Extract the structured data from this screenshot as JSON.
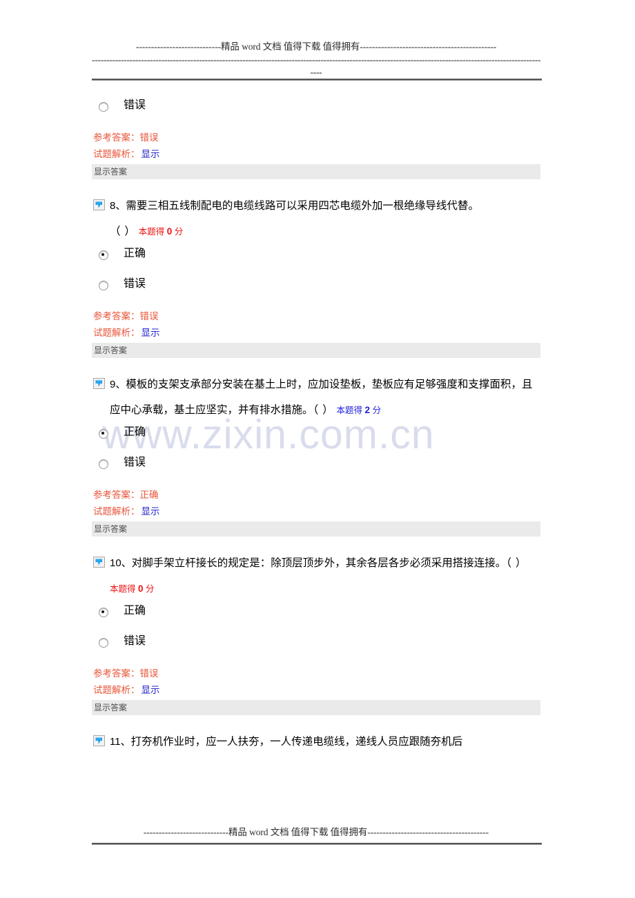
{
  "header": {
    "line1": "----------------------------精品 word 文档  值得下载  值得拥有---------------------------------------------",
    "line2": "-----------------------------------------------------------------------------------------------------------------------------------------------------------------",
    "line3": "----"
  },
  "footer": {
    "line1": "----------------------------精品 word 文档  值得下载  值得拥有----------------------------------------"
  },
  "watermark": {
    "text": "www.zixin.com.cn"
  },
  "labels": {
    "reference_answer": "参考答案：",
    "explanation": "试题解析：",
    "show_link": "显示",
    "show_answer_bar": "显示答案",
    "option_true": "正确",
    "option_false": "错误"
  },
  "blocks": [
    {
      "id": "q7-tail",
      "type": "answer-tail",
      "options": [
        {
          "label": "错误",
          "checked": false
        }
      ],
      "reference_answer": "错误",
      "explanation_link": "显示",
      "show_answer_bar": "显示答案"
    },
    {
      "id": "q8",
      "type": "question",
      "number": "8、",
      "text": "需要三相五线制配电的电缆线路可以采用四芯电缆外加一根绝缘导线代替。",
      "blank": "（  ）",
      "score_text_prefix": "本题得",
      "score_value": "0",
      "score_text_suffix": "分",
      "score_color": "red",
      "options": [
        {
          "label": "正确",
          "checked": true
        },
        {
          "label": "错误",
          "checked": false
        }
      ],
      "reference_answer": "错误",
      "explanation_link": "显示",
      "show_answer_bar": "显示答案"
    },
    {
      "id": "q9",
      "type": "question",
      "number": "9、",
      "text": "模板的支架支承部分安装在基土上时，应加设垫板，垫板应有足够强度和支撑面积，且应中心承载，基土应坚实，并有排水措施。",
      "blank": "（  ）",
      "score_text_prefix": "本题得",
      "score_value": "2",
      "score_text_suffix": "分",
      "score_color": "blue",
      "options": [
        {
          "label": "正确",
          "checked": true
        },
        {
          "label": "错误",
          "checked": false
        }
      ],
      "reference_answer": "正确",
      "explanation_link": "显示",
      "show_answer_bar": "显示答案"
    },
    {
      "id": "q10",
      "type": "question",
      "number": "10、",
      "text": "对脚手架立杆接长的规定是：除顶层顶步外，其余各层各步必须采用搭接连接。",
      "blank": "（  ）",
      "score_text_prefix": "本题得",
      "score_value": "0",
      "score_text_suffix": "分",
      "score_color": "red",
      "options": [
        {
          "label": "正确",
          "checked": true
        },
        {
          "label": "错误",
          "checked": false
        }
      ],
      "reference_answer": "错误",
      "explanation_link": "显示",
      "show_answer_bar": "显示答案"
    },
    {
      "id": "q11",
      "type": "question-partial",
      "number": "11、",
      "text": "打夯机作业时，应一人扶夯，一人传递电缆线，递线人员应跟随夯机后"
    }
  ]
}
